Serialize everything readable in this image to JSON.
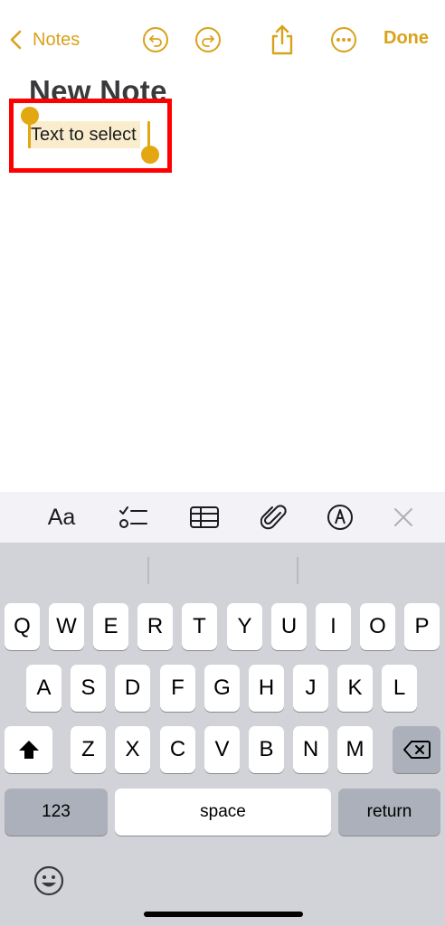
{
  "nav": {
    "back_label": "Notes",
    "done_label": "Done"
  },
  "note": {
    "title": "New Note",
    "selected_text": "Text to select"
  },
  "toolbar": {
    "format_label": "Aa",
    "icons": [
      "text-format-icon",
      "checklist-icon",
      "table-icon",
      "attachment-icon",
      "markup-icon",
      "close-icon"
    ]
  },
  "keyboard": {
    "row1": [
      "Q",
      "W",
      "E",
      "R",
      "T",
      "Y",
      "U",
      "I",
      "O",
      "P"
    ],
    "row2": [
      "A",
      "S",
      "D",
      "F",
      "G",
      "H",
      "J",
      "K",
      "L"
    ],
    "row3": [
      "Z",
      "X",
      "C",
      "V",
      "B",
      "N",
      "M"
    ],
    "numbers_label": "123",
    "space_label": "space",
    "return_label": "return"
  },
  "colors": {
    "accent": "#d9a21b",
    "selection": "#faedcd",
    "highlight_box": "#ff0000",
    "keyboard_bg": "#d1d3d9"
  }
}
